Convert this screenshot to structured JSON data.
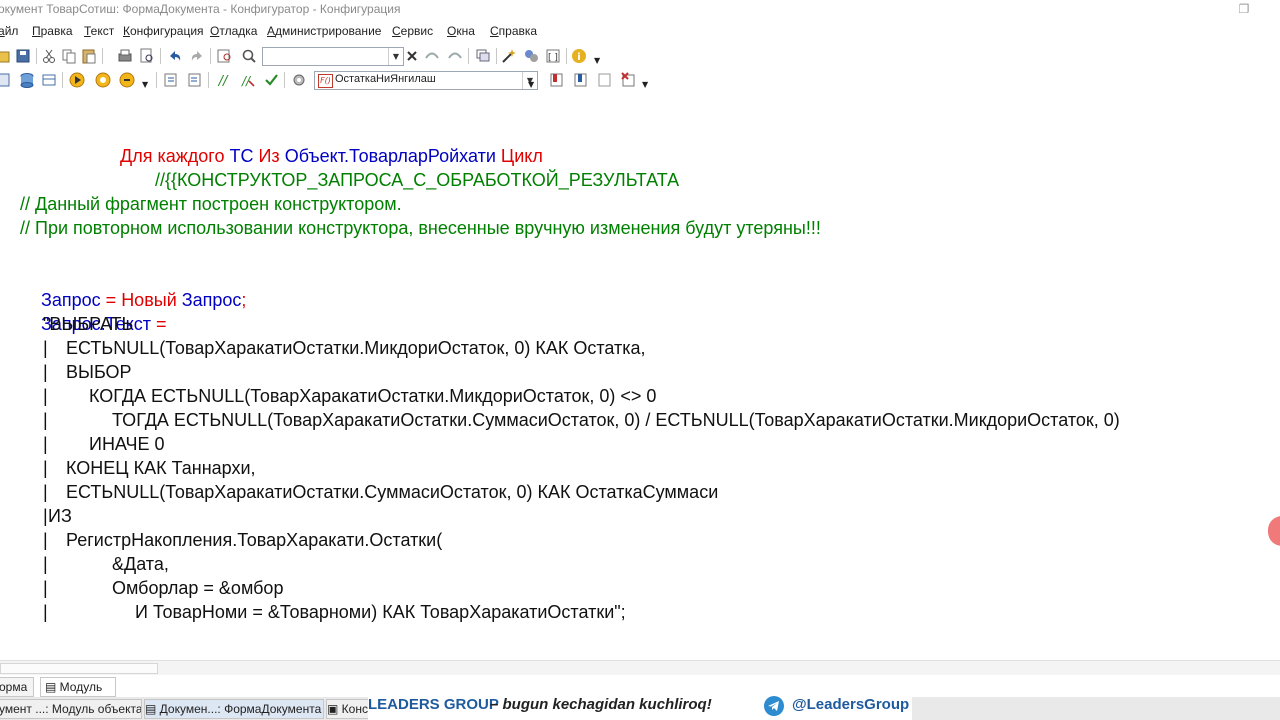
{
  "window": {
    "title": "окумент ТоварСотиш: ФормаДокумента - Конфигуратор - Конфигурация"
  },
  "menu": [
    "айл",
    "Правка",
    "Текст",
    "Конфигурация",
    "Отладка",
    "Администрирование",
    "Сервис",
    "Окна",
    "Справка"
  ],
  "toolbar": {
    "search_value": "",
    "procedure_combo_value": "ОстаткаНиЯнгилаш"
  },
  "code": {
    "l1": {
      "a": "Для каждого ",
      "b": "ТС ",
      "c": "Из ",
      "d": "Объект.ТоварларРойхати ",
      "e": "Цикл"
    },
    "l2": "//{{КОНСТРУКТОР_ЗАПРОСА_С_ОБРАБОТКОЙ_РЕЗУЛЬТАТА",
    "l3": "// Данный фрагмент построен конструктором.",
    "l4": "// При повторном использовании конструктора, внесенные вручную изменения будут утеряны!!!",
    "l5": {
      "a": "Запрос ",
      "b": "= ",
      "c": "Новый ",
      "d": "Запрос",
      "e": ";"
    },
    "l6": {
      "a": "Запрос.Текст ",
      "b": "="
    },
    "l7": "\"ВЫБРАТЬ",
    "l8": "ЕСТЬNULL(ТоварХаракатиОстатки.МикдориОстаток, 0) КАК Остатка,",
    "l9": "ВЫБОР",
    "l10": "КОГДА ЕСТЬNULL(ТоварХаракатиОстатки.МикдориОстаток, 0) <> 0",
    "l11": "ТОГДА ЕСТЬNULL(ТоварХаракатиОстатки.СуммасиОстаток, 0) / ЕСТЬNULL(ТоварХаракатиОстатки.МикдориОстаток, 0)",
    "l12": "ИНАЧЕ 0",
    "l13": "КОНЕЦ КАК Таннархи,",
    "l14": "ЕСТЬNULL(ТоварХаракатиОстатки.СуммасиОстаток, 0) КАК ОстаткаСуммаси",
    "l15": "ИЗ",
    "l16": "РегистрНакопления.ТоварХаракати.Остатки(",
    "l17": "&Дата,",
    "l18": "Омборлар = &омбор",
    "l19": "И ТоварНоми = &Товарноми) КАК ТоварХаракатиОстатки\";",
    "bar": "|"
  },
  "tabs": {
    "forma": "орма",
    "modul": "Модуль"
  },
  "taskbar": [
    "умент ...: Модуль объекта",
    "Докумен...: ФормаДокумента",
    "Конс"
  ],
  "banner": {
    "brand": "LEADERS GROUP",
    "slogan": "– bugun kechagidan kuchliroq!",
    "handle": "@LeadersGroup"
  },
  "colors": {
    "keyword": "#e00000",
    "identifier": "#0000c0",
    "comment": "#008000",
    "brand": "#1e5b9e",
    "telegram": "#2c8ccf"
  }
}
